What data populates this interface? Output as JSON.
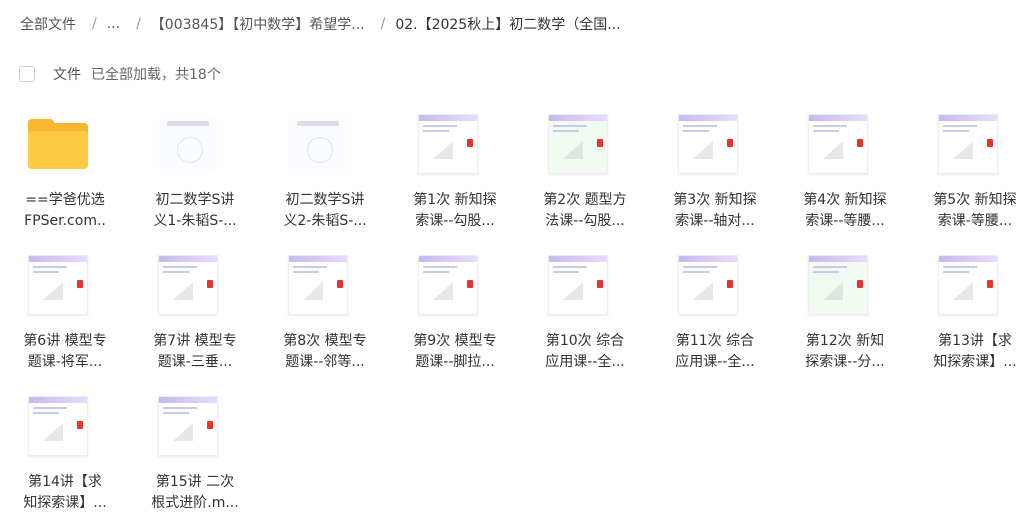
{
  "breadcrumb": {
    "root": "全部文件",
    "ellipsis": "...",
    "parent": "【003845】【初中数学】希望学...",
    "current": "02.【2025秋上】初二数学（全国...",
    "separator": "/"
  },
  "toolbar": {
    "column_label": "文件",
    "status": "已全部加载，共18个"
  },
  "files": [
    {
      "line1": "==学爸优选",
      "line2": "FPSer.com..",
      "thumb": "folder"
    },
    {
      "line1": "初二数学S讲",
      "line2": "义1-朱韬S-...",
      "thumb": "cover"
    },
    {
      "line1": "初二数学S讲",
      "line2": "义2-朱韬S-...",
      "thumb": "cover"
    },
    {
      "line1": "第1次 新知探",
      "line2": "索课--勾股...",
      "thumb": "doc"
    },
    {
      "line1": "第2次 题型方",
      "line2": "法课--勾股...",
      "thumb": "doc-green"
    },
    {
      "line1": "第3次 新知探",
      "line2": "索课--轴对...",
      "thumb": "doc"
    },
    {
      "line1": "第4次 新知探",
      "line2": "索课--等腰...",
      "thumb": "doc"
    },
    {
      "line1": "第5次 新知探",
      "line2": "索课-等腰...",
      "thumb": "doc"
    },
    {
      "line1": "第6讲 模型专",
      "line2": "题课-将军...",
      "thumb": "doc"
    },
    {
      "line1": "第7讲 模型专",
      "line2": "题课-三垂...",
      "thumb": "doc"
    },
    {
      "line1": "第8次 模型专",
      "line2": "题课--邻等...",
      "thumb": "doc"
    },
    {
      "line1": "第9次 模型专",
      "line2": "题课--脚拉...",
      "thumb": "doc"
    },
    {
      "line1": "第10次 综合",
      "line2": "应用课--全...",
      "thumb": "doc"
    },
    {
      "line1": "第11次 综合",
      "line2": "应用课--全...",
      "thumb": "doc"
    },
    {
      "line1": "第12次 新知",
      "line2": "探索课--分...",
      "thumb": "doc-green"
    },
    {
      "line1": "第13讲【求",
      "line2": "知探索课】...",
      "thumb": "doc"
    },
    {
      "line1": "第14讲【求",
      "line2": "知探索课】...",
      "thumb": "doc"
    },
    {
      "line1": "第15讲 二次",
      "line2": "根式进阶.m...",
      "thumb": "doc"
    }
  ]
}
